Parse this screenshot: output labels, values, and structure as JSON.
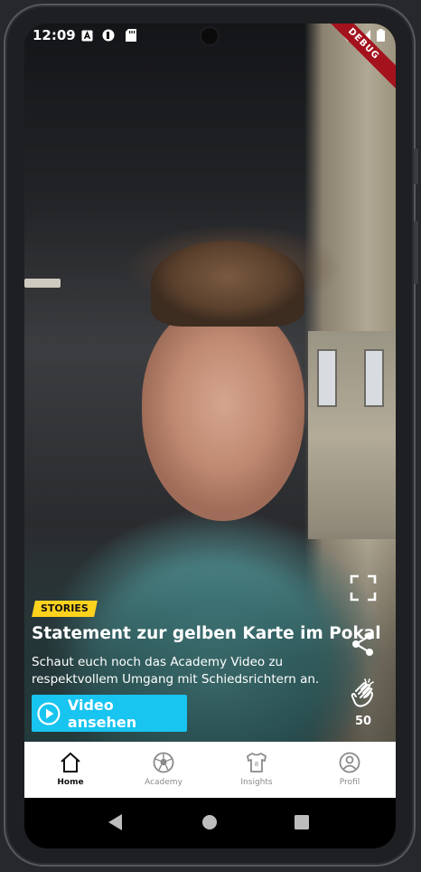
{
  "status_bar": {
    "time": "12:09"
  },
  "debug_banner": "DEBUG",
  "story": {
    "tag": "STORIES",
    "title": "Statement zur gelben Karte im Pokal",
    "description": "Schaut euch noch das Academy Video zu respektvollem Umgang mit Schiedsrichtern an.",
    "cta_label": "Video ansehen",
    "clap_count": "50"
  },
  "bottom_nav": {
    "items": [
      {
        "label": "Home",
        "icon": "home-icon",
        "active": true
      },
      {
        "label": "Academy",
        "icon": "football-icon",
        "active": false
      },
      {
        "label": "Insights",
        "icon": "jersey-icon",
        "active": false
      },
      {
        "label": "Profil",
        "icon": "profile-icon",
        "active": false
      }
    ]
  },
  "colors": {
    "accent": "#18c4f0",
    "tag": "#ffd21e",
    "debug": "#a3121d"
  }
}
